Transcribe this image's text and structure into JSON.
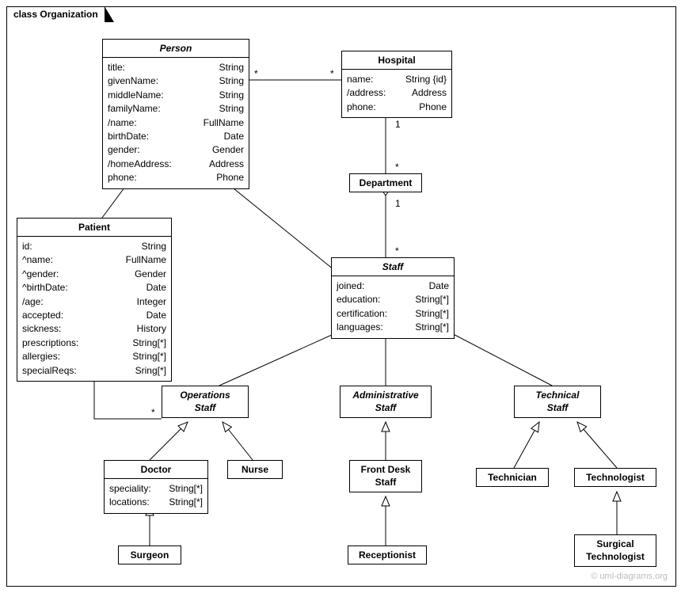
{
  "frame": {
    "title": "class Organization"
  },
  "watermark": "© uml-diagrams.org",
  "classes": {
    "person": {
      "name": "Person",
      "attrs": [
        {
          "name": "title:",
          "type": "String"
        },
        {
          "name": "givenName:",
          "type": "String"
        },
        {
          "name": "middleName:",
          "type": "String"
        },
        {
          "name": "familyName:",
          "type": "String"
        },
        {
          "name": "/name:",
          "type": "FullName"
        },
        {
          "name": "birthDate:",
          "type": "Date"
        },
        {
          "name": "gender:",
          "type": "Gender"
        },
        {
          "name": "/homeAddress:",
          "type": "Address"
        },
        {
          "name": "phone:",
          "type": "Phone"
        }
      ]
    },
    "hospital": {
      "name": "Hospital",
      "attrs": [
        {
          "name": "name:",
          "type": "String {id}"
        },
        {
          "name": "/address:",
          "type": "Address"
        },
        {
          "name": "phone:",
          "type": "Phone"
        }
      ]
    },
    "department": {
      "name": "Department"
    },
    "patient": {
      "name": "Patient",
      "attrs": [
        {
          "name": "id:",
          "type": "String"
        },
        {
          "name": "^name:",
          "type": "FullName"
        },
        {
          "name": "^gender:",
          "type": "Gender"
        },
        {
          "name": "^birthDate:",
          "type": "Date"
        },
        {
          "name": "/age:",
          "type": "Integer"
        },
        {
          "name": "accepted:",
          "type": "Date"
        },
        {
          "name": "sickness:",
          "type": "History"
        },
        {
          "name": "prescriptions:",
          "type": "String[*]"
        },
        {
          "name": "allergies:",
          "type": "String[*]"
        },
        {
          "name": "specialReqs:",
          "type": "Sring[*]"
        }
      ]
    },
    "staff": {
      "name": "Staff",
      "attrs": [
        {
          "name": "joined:",
          "type": "Date"
        },
        {
          "name": "education:",
          "type": "String[*]"
        },
        {
          "name": "certification:",
          "type": "String[*]"
        },
        {
          "name": "languages:",
          "type": "String[*]"
        }
      ]
    },
    "opsStaff": {
      "name1": "Operations",
      "name2": "Staff"
    },
    "adminStaff": {
      "name1": "Administrative",
      "name2": "Staff"
    },
    "techStaff": {
      "name1": "Technical",
      "name2": "Staff"
    },
    "doctor": {
      "name": "Doctor",
      "attrs": [
        {
          "name": "speciality:",
          "type": "String[*]"
        },
        {
          "name": "locations:",
          "type": "String[*]"
        }
      ]
    },
    "nurse": {
      "name": "Nurse"
    },
    "frontDesk": {
      "name1": "Front Desk",
      "name2": "Staff"
    },
    "technician": {
      "name": "Technician"
    },
    "technologist": {
      "name": "Technologist"
    },
    "surgeon": {
      "name": "Surgeon"
    },
    "receptionist": {
      "name": "Receptionist"
    },
    "surgTech": {
      "name1": "Surgical",
      "name2": "Technologist"
    }
  },
  "multiplicities": {
    "personHospital_left": "*",
    "personHospital_right": "*",
    "hospitalDept_top": "1",
    "hospitalDept_bottom": "*",
    "deptStaff_top": "1",
    "deptStaff_bottom": "*",
    "patientOps_left": "*",
    "patientOps_right": "*"
  }
}
